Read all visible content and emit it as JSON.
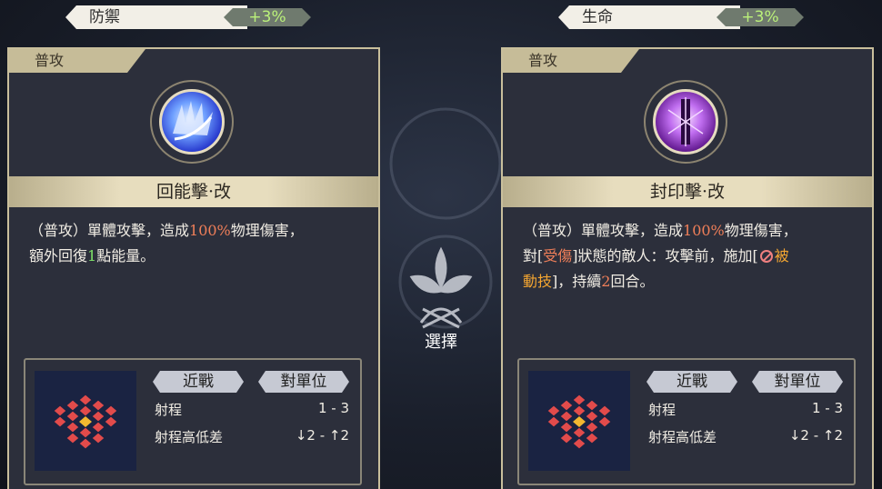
{
  "left_stat": {
    "label": "防禦",
    "value": "+3%"
  },
  "right_stat": {
    "label": "生命",
    "value": "+3%"
  },
  "left_card": {
    "tag": "普攻",
    "icon": "ice-claw-skill-icon",
    "name": "回能擊·改",
    "desc": {
      "line1_a": "（普攻）單體攻擊，造成",
      "line1_pct": "100%",
      "line1_b": "物理傷害，",
      "line2_a": "額外回復",
      "line2_num": "1",
      "line2_b": "點能量。"
    },
    "range_type": "近戰",
    "target": "對單位",
    "range_label": "射程",
    "range_value": "1 - 3",
    "height_label": "射程高低差",
    "height_value": "↓2 - ↑2"
  },
  "right_card": {
    "tag": "普攻",
    "icon": "seal-sword-skill-icon",
    "name": "封印擊·改",
    "desc": {
      "line1_a": "（普攻）單體攻擊，造成",
      "line1_pct": "100%",
      "line1_b": "物理傷害，",
      "line2_a": "對[",
      "line2_status": "受傷",
      "line2_b": "]狀態的敵人：攻擊前，施加[",
      "line2_eff": "被",
      "line3_eff": "動技",
      "line3_a": "]，持續",
      "line3_num": "2",
      "line3_b": "回合。"
    },
    "range_type": "近戰",
    "target": "對單位",
    "range_label": "射程",
    "range_value": "1 - 3",
    "height_label": "射程高低差",
    "height_value": "↓2 - ↑2"
  },
  "center": {
    "label": "選擇",
    "icon": "leaf-emblem-icon"
  },
  "colors": {
    "accent_gold": "#c6bc98",
    "highlight_red": "#f07f59",
    "highlight_green": "#7fe46a",
    "highlight_orange": "#f3a531",
    "stat_green": "#baf07a"
  }
}
